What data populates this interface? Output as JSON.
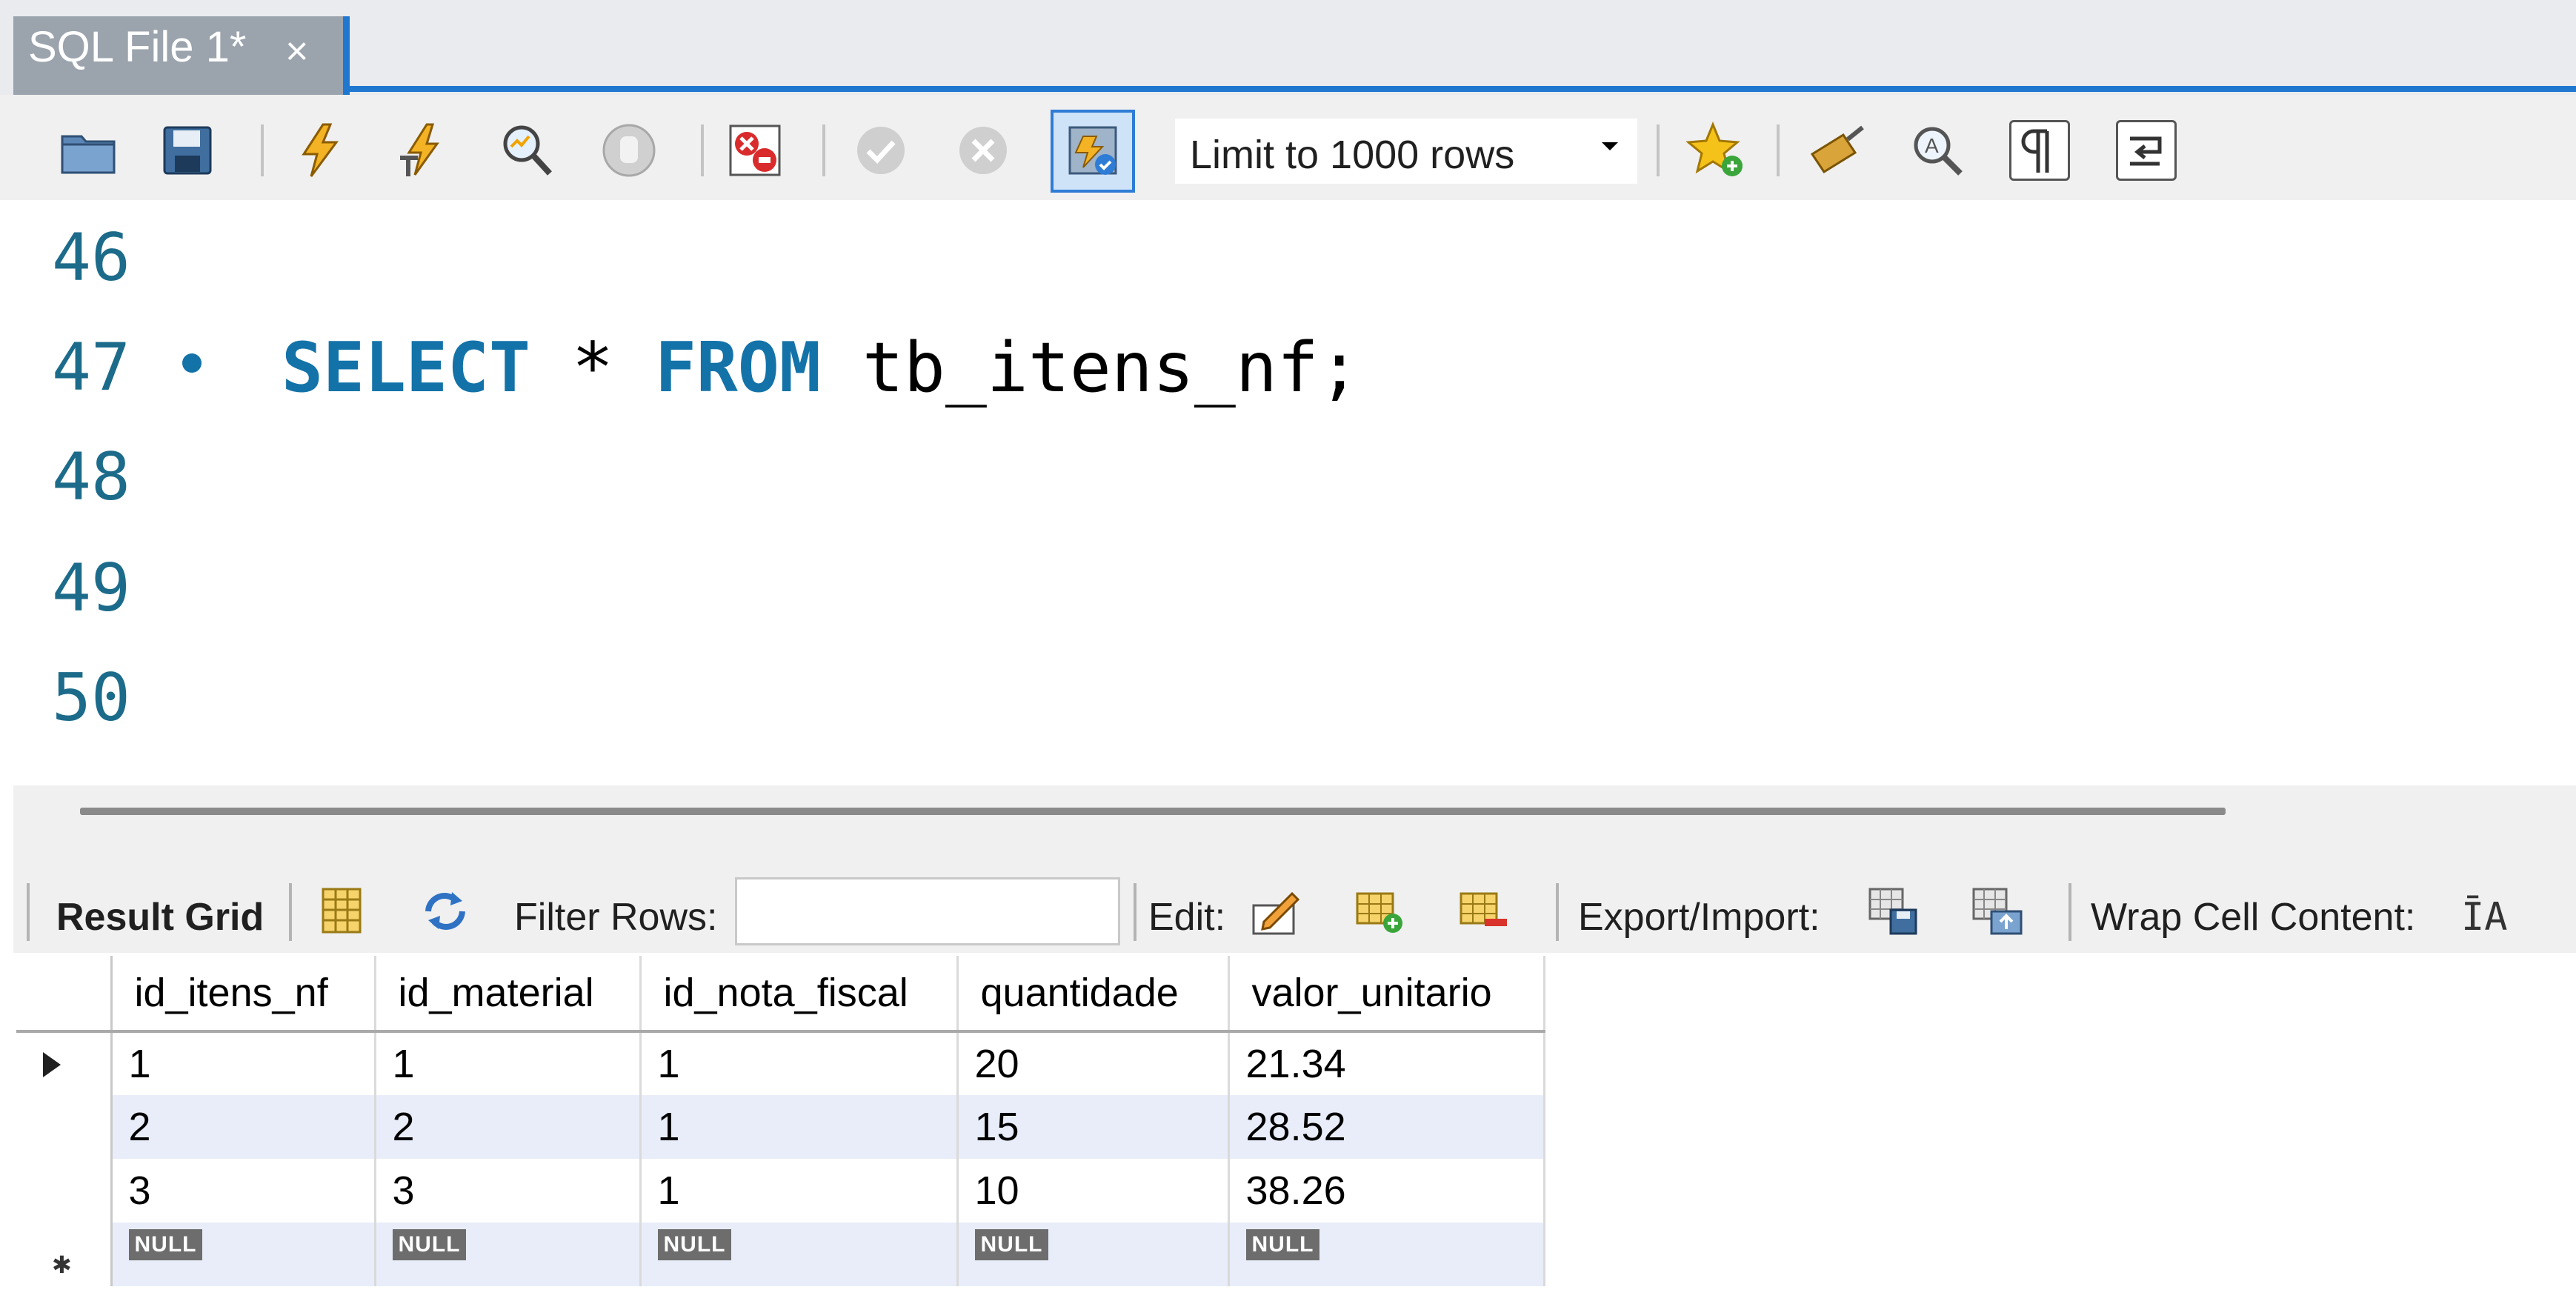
{
  "tab": {
    "title": "SQL File 1*",
    "close": "×"
  },
  "toolbar": {
    "icons": [
      "folder-icon",
      "save-icon",
      "execute-icon",
      "execute-current-icon",
      "explain-icon",
      "stop-icon",
      "toggle-error-icon",
      "commit-icon",
      "rollback-icon",
      "autocommit-icon",
      "bookmark-icon",
      "beautify-icon",
      "find-icon",
      "invisible-chars-icon",
      "wrap-icon"
    ],
    "limit": "Limit to 1000 rows"
  },
  "editor": {
    "lines": [
      "46",
      "47",
      "48",
      "49",
      "50"
    ],
    "sql": {
      "kw1": "SELECT",
      "star": " * ",
      "kw2": "FROM",
      "rest": " tb_itens_nf;"
    }
  },
  "results": {
    "tab_label": "Result Grid",
    "filter_label": "Filter Rows:",
    "filter_value": "",
    "edit_label": "Edit:",
    "export_label": "Export/Import:",
    "wrap_label": "Wrap Cell Content:",
    "wrap_glyph": "ĪA",
    "columns": [
      "id_itens_nf",
      "id_material",
      "id_nota_fiscal",
      "quantidade",
      "valor_unitario"
    ],
    "rows": [
      [
        "1",
        "1",
        "1",
        "20",
        "21.34"
      ],
      [
        "2",
        "2",
        "1",
        "15",
        "28.52"
      ],
      [
        "3",
        "3",
        "1",
        "10",
        "38.26"
      ]
    ],
    "null_label": "NULL"
  },
  "colors": {
    "accent": "#1f77d0",
    "keyword": "#1373a9",
    "line_number": "#1c6b8a",
    "alt_row": "#e8edf9"
  }
}
